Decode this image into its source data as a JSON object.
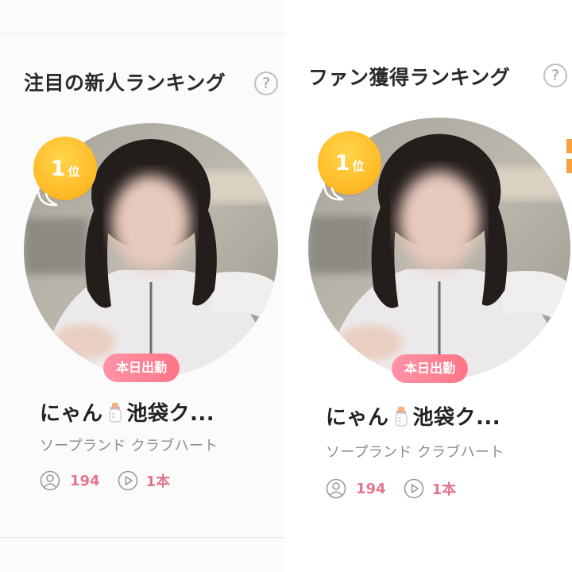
{
  "cards": [
    {
      "section_title": "注目の新人ランキング",
      "help_icon": "question-circle-icon",
      "rank_number": "1",
      "rank_unit": "位",
      "work_badge": "本日出勤",
      "name": "にゃん",
      "name_icon": "baby-bottle-icon",
      "name_rest": "池袋ク...",
      "shop": "ソープランド クラブハート",
      "followers": "194",
      "videos": "1本"
    },
    {
      "section_title": "ファン獲得ランキング",
      "help_icon": "question-circle-icon",
      "rank_number": "1",
      "rank_unit": "位",
      "work_badge": "本日出勤",
      "name": "にゃん",
      "name_icon": "baby-bottle-icon",
      "name_rest": "池袋ク...",
      "shop": "ソープランド クラブハート",
      "followers": "194",
      "videos": "1本"
    }
  ],
  "colors": {
    "badge_gold": "#ffbd2a",
    "pill_pink": "#ff7e91",
    "stat_pink": "#e2768d",
    "muted_text": "#8d8d8d"
  }
}
